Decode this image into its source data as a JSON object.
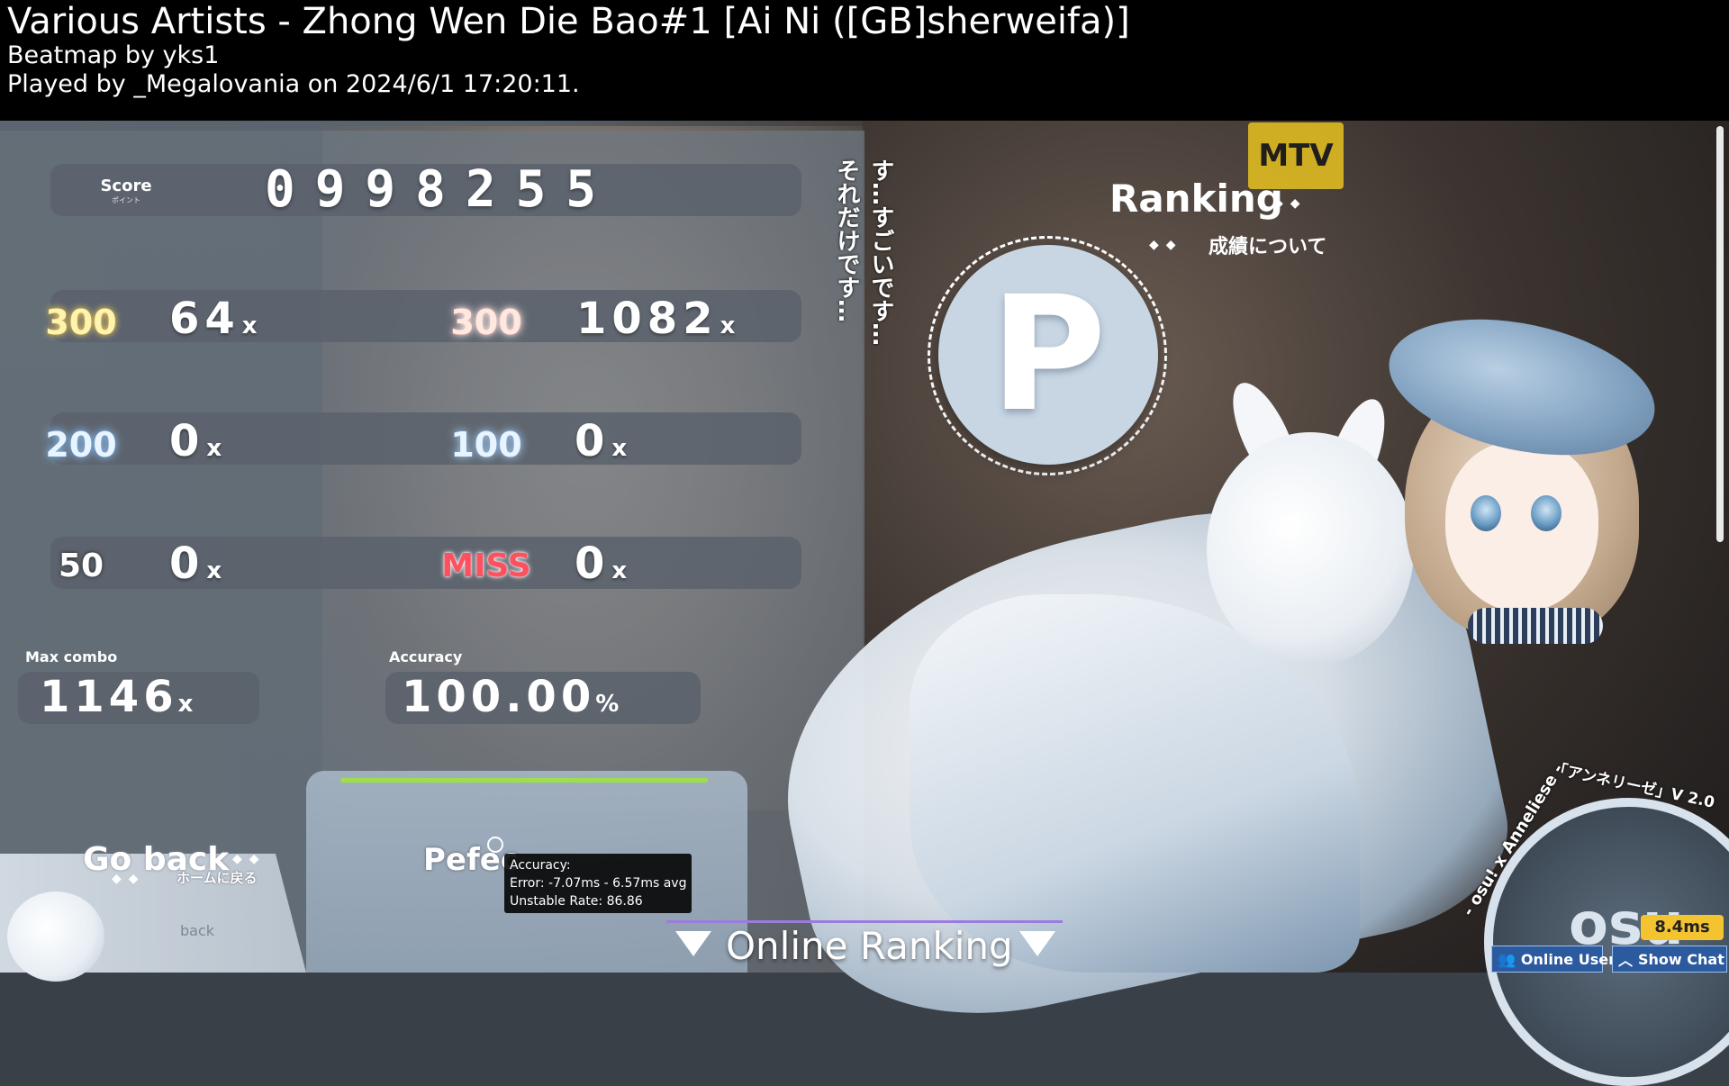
{
  "header": {
    "title": "Various Artists - Zhong Wen Die Bao#1 [Ai Ni ([GB]sherweifa)]",
    "beatmap_by": "Beatmap by yks1",
    "played_by": "Played by _Megalovania on 2024/6/1 17:20:11."
  },
  "score": {
    "label": "Score",
    "sublabel": "ポイント",
    "value": "0998255"
  },
  "judgements": {
    "j300": {
      "label": "300",
      "count": "64"
    },
    "geki": {
      "label": "300",
      "count": "1082"
    },
    "j200": {
      "label": "200",
      "count": "0"
    },
    "j100": {
      "label": "100",
      "count": "0"
    },
    "j50": {
      "label": "50",
      "count": "0"
    },
    "miss": {
      "label": "MISS",
      "count": "0"
    },
    "suffix": "x"
  },
  "max_combo": {
    "label": "Max combo",
    "value": "1146",
    "suffix": "x"
  },
  "accuracy": {
    "label": "Accuracy",
    "value": "100.00",
    "suffix": "%"
  },
  "vertical_text": {
    "line1": "す…すごいです…",
    "line2": "それだけです…"
  },
  "ranking": {
    "title": "Ranking",
    "subtitle": "成績について",
    "grade": "P"
  },
  "bottom": {
    "go_back": "Go back",
    "go_back_sub": "ホームに戻る",
    "back_small": "back",
    "perfect_label": "Pefec",
    "tooltip": {
      "line1": "Accuracy:",
      "line2": "Error: -7.07ms - 6.57ms avg",
      "line3": "Unstable Rate: 86.86"
    },
    "online_ranking": "Online Ranking",
    "credit": "- osu! x Anneliese -",
    "credit2": "「アンネリーゼ」V 2.0",
    "osu_text": "osu",
    "latency": "8.4ms",
    "online_users": "Online Users",
    "show_chat": "Show Chat"
  },
  "bg": {
    "mtv": "MTV"
  }
}
